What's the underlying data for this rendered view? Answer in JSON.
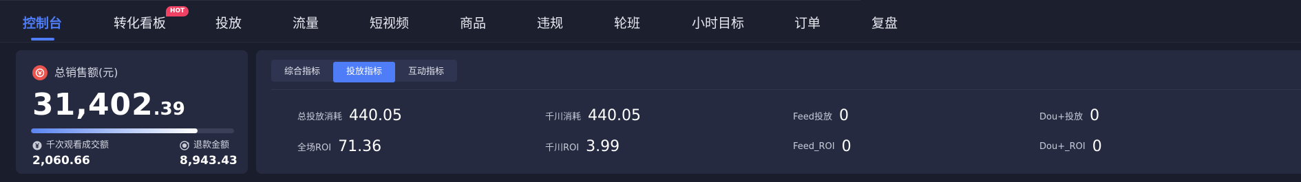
{
  "nav": {
    "items": [
      {
        "label": "控制台"
      },
      {
        "label": "转化看板"
      },
      {
        "label": "投放"
      },
      {
        "label": "流量"
      },
      {
        "label": "短视频"
      },
      {
        "label": "商品"
      },
      {
        "label": "违规"
      },
      {
        "label": "轮班"
      },
      {
        "label": "小时目标"
      },
      {
        "label": "订单"
      },
      {
        "label": "复盘"
      }
    ],
    "active_index": 0,
    "hot_badge": "HOT"
  },
  "sales": {
    "label": "总销售额(元)",
    "value_int": "31,402",
    "value_dec": ".39",
    "progress_fraction": 0.82,
    "sub_left": {
      "label": "千次观看成交额",
      "value": "2,060.66"
    },
    "sub_right": {
      "label": "退款金额",
      "value": "8,943.43"
    }
  },
  "metrics_panel": {
    "tabs": [
      {
        "label": "综合指标"
      },
      {
        "label": "投放指标"
      },
      {
        "label": "互动指标"
      }
    ],
    "active_tab": 1,
    "rows": [
      [
        {
          "label": "总投放消耗",
          "value": "440.05"
        },
        {
          "label": "千川消耗",
          "value": "440.05"
        },
        {
          "label": "Feed投放",
          "value": "0"
        },
        {
          "label": "Dou+投放",
          "value": "0"
        }
      ],
      [
        {
          "label": "全场ROI",
          "value": "71.36"
        },
        {
          "label": "千川ROI",
          "value": "3.99"
        },
        {
          "label": "Feed_ROI",
          "value": "0"
        },
        {
          "label": "Dou+_ROI",
          "value": "0"
        }
      ]
    ]
  },
  "colors": {
    "accent": "#4f7cf7",
    "hot": "#ef4164",
    "sales_icon": "#e9544f"
  }
}
